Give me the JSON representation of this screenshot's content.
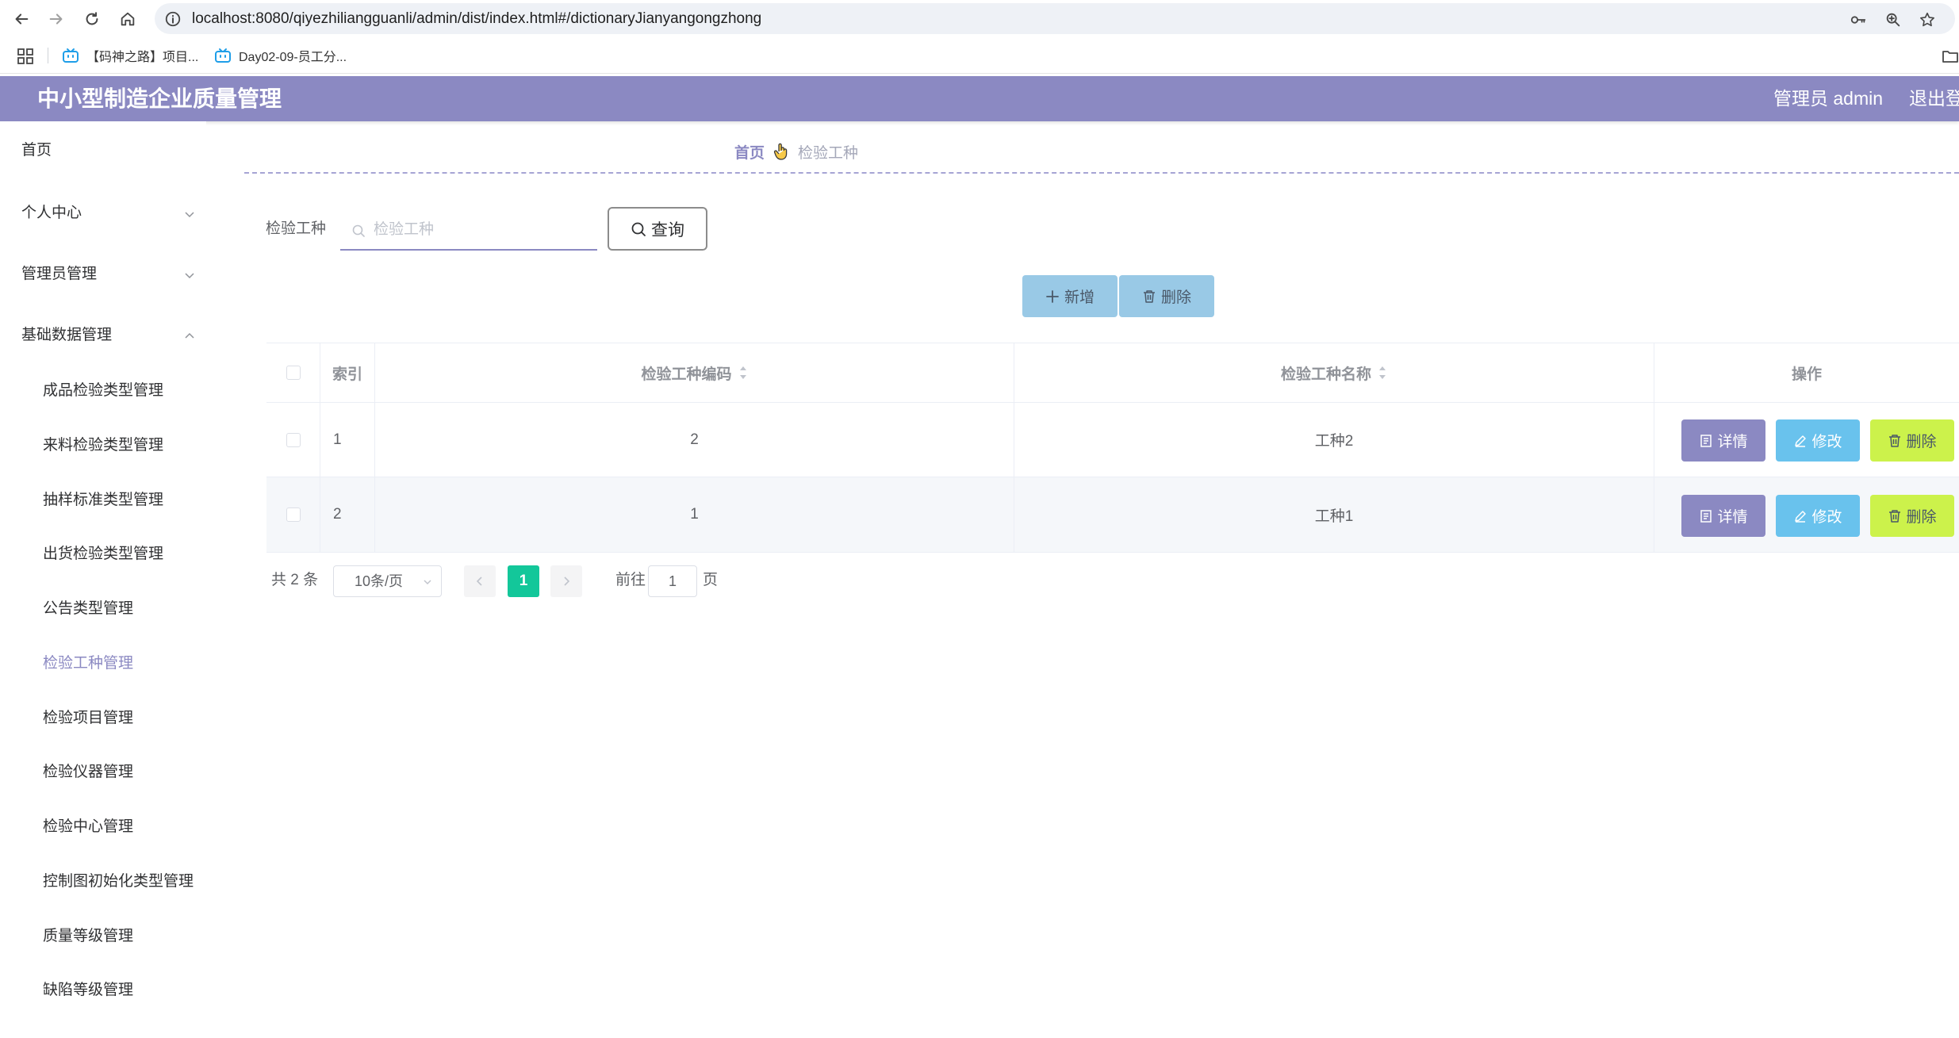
{
  "browser": {
    "url": "localhost:8080/qiyezhiliangguanli/admin/dist/index.html#/dictionaryJianyangongzhong",
    "bookmarks": [
      {
        "label": "【码神之路】项目..."
      },
      {
        "label": "Day02-09-员工分..."
      }
    ]
  },
  "header": {
    "title": "中小型制造企业质量管理",
    "admin": "管理员 admin",
    "logout": "退出登"
  },
  "sidebar": {
    "menus": [
      {
        "label": "首页"
      },
      {
        "label": "个人中心"
      },
      {
        "label": "管理员管理"
      },
      {
        "label": "基础数据管理"
      }
    ],
    "sub_items": [
      {
        "label": "成品检验类型管理"
      },
      {
        "label": "来料检验类型管理"
      },
      {
        "label": "抽样标准类型管理"
      },
      {
        "label": "出货检验类型管理"
      },
      {
        "label": "公告类型管理"
      },
      {
        "label": "检验工种管理"
      },
      {
        "label": "检验项目管理"
      },
      {
        "label": "检验仪器管理"
      },
      {
        "label": "检验中心管理"
      },
      {
        "label": "控制图初始化类型管理"
      },
      {
        "label": "质量等级管理"
      },
      {
        "label": "缺陷等级管理"
      }
    ]
  },
  "breadcrumb": {
    "home": "首页",
    "current": "检验工种"
  },
  "search": {
    "label": "检验工种",
    "placeholder": "检验工种",
    "value": "",
    "button": "查询"
  },
  "actions": {
    "add": "新增",
    "delete": "删除"
  },
  "table": {
    "columns": {
      "index": "索引",
      "code": "检验工种编码",
      "name": "检验工种名称",
      "ops": "操作"
    },
    "rows": [
      {
        "index": "1",
        "code": "2",
        "name": "工种2"
      },
      {
        "index": "2",
        "code": "1",
        "name": "工种1"
      }
    ],
    "row_buttons": {
      "detail": "详情",
      "edit": "修改",
      "delete": "删除"
    }
  },
  "pagination": {
    "total": "共 2 条",
    "page_size": "10条/页",
    "current": "1",
    "goto_label": "前往",
    "goto_value": "1",
    "page_suffix": "页"
  },
  "colors": {
    "header_bg": "#8b89c2",
    "active_menu": "#8b89c2",
    "detail_btn": "#8b89c2",
    "edit_btn": "#69c2ed",
    "delete_btn": "#ccf24b",
    "pager_active": "#13c79a",
    "toolbar_btn": "#99c9e6"
  },
  "icons": [
    "back-icon",
    "forward-icon",
    "reload-icon",
    "home-icon",
    "site-info-icon",
    "key-icon",
    "zoom-icon",
    "star-icon",
    "apps-grid-icon",
    "bilibili-icon",
    "folder-icon",
    "chevron-down-icon",
    "chevron-up-icon",
    "hand-pointer-icon",
    "search-icon",
    "plus-icon",
    "trash-icon",
    "document-icon",
    "edit-pen-icon",
    "sort-caret-icon",
    "arrow-left-icon",
    "arrow-right-icon"
  ]
}
